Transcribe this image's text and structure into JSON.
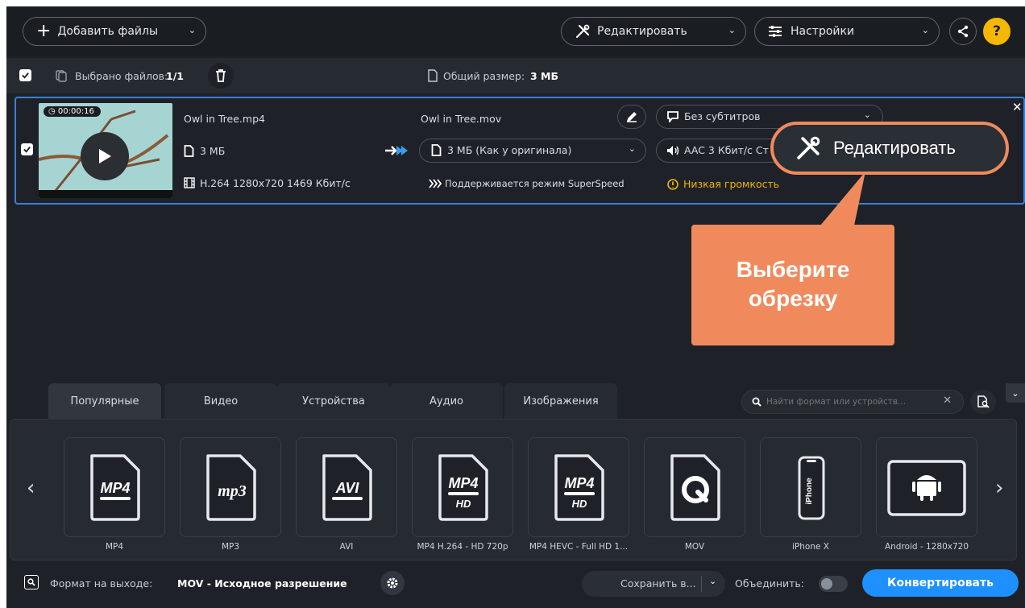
{
  "toolbar": {
    "add_files": "Добавить файлы",
    "edit": "Редактировать",
    "settings": "Настройки",
    "help": "?"
  },
  "selection": {
    "selected_label": "Выбрано файлов:",
    "selected_value": "1/1",
    "total_label": "Общий размер:",
    "total_value": "3 МБ"
  },
  "file": {
    "duration": "00:00:16",
    "source_name": "Owl in Tree.mp4",
    "source_size": "3 МБ",
    "source_codec": "H.264 1280x720 1469 Кбит/с",
    "output_name": "Owl in Tree.mov",
    "output_size": "3 МБ (Как у оригинала)",
    "superspeed": "Поддерживается режим SuperSpeed",
    "subtitles": "Без субтитров",
    "audio": "AAC 3 Кбит/с Ст",
    "low_volume": "Низкая громкость"
  },
  "callout": {
    "edit_button": "Редактировать",
    "hint_line1": "Выберите",
    "hint_line2": "обрезку",
    "accent_color": "#f08a5d"
  },
  "tabs": [
    {
      "label": "Популярные",
      "active": true
    },
    {
      "label": "Видео"
    },
    {
      "label": "Устройства"
    },
    {
      "label": "Аудио"
    },
    {
      "label": "Изображения"
    }
  ],
  "search": {
    "placeholder": "Найти формат или устройств..."
  },
  "formats": [
    {
      "label": "MP4",
      "icon": "mp4-icon"
    },
    {
      "label": "MP3",
      "icon": "mp3-icon"
    },
    {
      "label": "AVI",
      "icon": "avi-icon"
    },
    {
      "label": "MP4 H.264 - HD 720p",
      "icon": "mp4-hd-icon"
    },
    {
      "label": "MP4 HEVC - Full HD 1...",
      "icon": "mp4-hd-icon"
    },
    {
      "label": "MOV",
      "icon": "quicktime-icon"
    },
    {
      "label": "iPhone X",
      "icon": "iphone-icon"
    },
    {
      "label": "Android - 1280x720",
      "icon": "android-icon"
    }
  ],
  "format_badges": {
    "mp4": "MP4",
    "mp3": "mp3",
    "avi": "AVI",
    "hd": "HD",
    "iphone": "iPhone"
  },
  "footer": {
    "output_label": "Формат на выходе:",
    "output_value": "MOV - Исходное разрешение",
    "save_to": "Сохранить в...",
    "merge": "Объединить:",
    "convert": "Конвертировать"
  },
  "colors": {
    "accent_blue": "#1e90ff",
    "warning": "#f0b400",
    "selection_border": "#3b7fd6"
  }
}
